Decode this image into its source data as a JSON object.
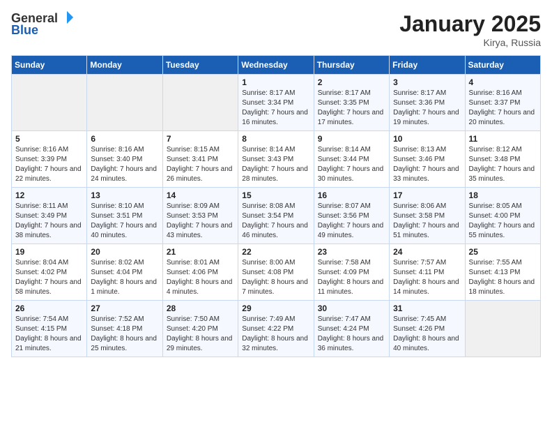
{
  "logo": {
    "text_general": "General",
    "text_blue": "Blue"
  },
  "title": "January 2025",
  "location": "Kirya, Russia",
  "days_of_week": [
    "Sunday",
    "Monday",
    "Tuesday",
    "Wednesday",
    "Thursday",
    "Friday",
    "Saturday"
  ],
  "weeks": [
    [
      {
        "day": "",
        "sunrise": "",
        "sunset": "",
        "daylight": ""
      },
      {
        "day": "",
        "sunrise": "",
        "sunset": "",
        "daylight": ""
      },
      {
        "day": "",
        "sunrise": "",
        "sunset": "",
        "daylight": ""
      },
      {
        "day": "1",
        "sunrise": "Sunrise: 8:17 AM",
        "sunset": "Sunset: 3:34 PM",
        "daylight": "Daylight: 7 hours and 16 minutes."
      },
      {
        "day": "2",
        "sunrise": "Sunrise: 8:17 AM",
        "sunset": "Sunset: 3:35 PM",
        "daylight": "Daylight: 7 hours and 17 minutes."
      },
      {
        "day": "3",
        "sunrise": "Sunrise: 8:17 AM",
        "sunset": "Sunset: 3:36 PM",
        "daylight": "Daylight: 7 hours and 19 minutes."
      },
      {
        "day": "4",
        "sunrise": "Sunrise: 8:16 AM",
        "sunset": "Sunset: 3:37 PM",
        "daylight": "Daylight: 7 hours and 20 minutes."
      }
    ],
    [
      {
        "day": "5",
        "sunrise": "Sunrise: 8:16 AM",
        "sunset": "Sunset: 3:39 PM",
        "daylight": "Daylight: 7 hours and 22 minutes."
      },
      {
        "day": "6",
        "sunrise": "Sunrise: 8:16 AM",
        "sunset": "Sunset: 3:40 PM",
        "daylight": "Daylight: 7 hours and 24 minutes."
      },
      {
        "day": "7",
        "sunrise": "Sunrise: 8:15 AM",
        "sunset": "Sunset: 3:41 PM",
        "daylight": "Daylight: 7 hours and 26 minutes."
      },
      {
        "day": "8",
        "sunrise": "Sunrise: 8:14 AM",
        "sunset": "Sunset: 3:43 PM",
        "daylight": "Daylight: 7 hours and 28 minutes."
      },
      {
        "day": "9",
        "sunrise": "Sunrise: 8:14 AM",
        "sunset": "Sunset: 3:44 PM",
        "daylight": "Daylight: 7 hours and 30 minutes."
      },
      {
        "day": "10",
        "sunrise": "Sunrise: 8:13 AM",
        "sunset": "Sunset: 3:46 PM",
        "daylight": "Daylight: 7 hours and 33 minutes."
      },
      {
        "day": "11",
        "sunrise": "Sunrise: 8:12 AM",
        "sunset": "Sunset: 3:48 PM",
        "daylight": "Daylight: 7 hours and 35 minutes."
      }
    ],
    [
      {
        "day": "12",
        "sunrise": "Sunrise: 8:11 AM",
        "sunset": "Sunset: 3:49 PM",
        "daylight": "Daylight: 7 hours and 38 minutes."
      },
      {
        "day": "13",
        "sunrise": "Sunrise: 8:10 AM",
        "sunset": "Sunset: 3:51 PM",
        "daylight": "Daylight: 7 hours and 40 minutes."
      },
      {
        "day": "14",
        "sunrise": "Sunrise: 8:09 AM",
        "sunset": "Sunset: 3:53 PM",
        "daylight": "Daylight: 7 hours and 43 minutes."
      },
      {
        "day": "15",
        "sunrise": "Sunrise: 8:08 AM",
        "sunset": "Sunset: 3:54 PM",
        "daylight": "Daylight: 7 hours and 46 minutes."
      },
      {
        "day": "16",
        "sunrise": "Sunrise: 8:07 AM",
        "sunset": "Sunset: 3:56 PM",
        "daylight": "Daylight: 7 hours and 49 minutes."
      },
      {
        "day": "17",
        "sunrise": "Sunrise: 8:06 AM",
        "sunset": "Sunset: 3:58 PM",
        "daylight": "Daylight: 7 hours and 51 minutes."
      },
      {
        "day": "18",
        "sunrise": "Sunrise: 8:05 AM",
        "sunset": "Sunset: 4:00 PM",
        "daylight": "Daylight: 7 hours and 55 minutes."
      }
    ],
    [
      {
        "day": "19",
        "sunrise": "Sunrise: 8:04 AM",
        "sunset": "Sunset: 4:02 PM",
        "daylight": "Daylight: 7 hours and 58 minutes."
      },
      {
        "day": "20",
        "sunrise": "Sunrise: 8:02 AM",
        "sunset": "Sunset: 4:04 PM",
        "daylight": "Daylight: 8 hours and 1 minute."
      },
      {
        "day": "21",
        "sunrise": "Sunrise: 8:01 AM",
        "sunset": "Sunset: 4:06 PM",
        "daylight": "Daylight: 8 hours and 4 minutes."
      },
      {
        "day": "22",
        "sunrise": "Sunrise: 8:00 AM",
        "sunset": "Sunset: 4:08 PM",
        "daylight": "Daylight: 8 hours and 7 minutes."
      },
      {
        "day": "23",
        "sunrise": "Sunrise: 7:58 AM",
        "sunset": "Sunset: 4:09 PM",
        "daylight": "Daylight: 8 hours and 11 minutes."
      },
      {
        "day": "24",
        "sunrise": "Sunrise: 7:57 AM",
        "sunset": "Sunset: 4:11 PM",
        "daylight": "Daylight: 8 hours and 14 minutes."
      },
      {
        "day": "25",
        "sunrise": "Sunrise: 7:55 AM",
        "sunset": "Sunset: 4:13 PM",
        "daylight": "Daylight: 8 hours and 18 minutes."
      }
    ],
    [
      {
        "day": "26",
        "sunrise": "Sunrise: 7:54 AM",
        "sunset": "Sunset: 4:15 PM",
        "daylight": "Daylight: 8 hours and 21 minutes."
      },
      {
        "day": "27",
        "sunrise": "Sunrise: 7:52 AM",
        "sunset": "Sunset: 4:18 PM",
        "daylight": "Daylight: 8 hours and 25 minutes."
      },
      {
        "day": "28",
        "sunrise": "Sunrise: 7:50 AM",
        "sunset": "Sunset: 4:20 PM",
        "daylight": "Daylight: 8 hours and 29 minutes."
      },
      {
        "day": "29",
        "sunrise": "Sunrise: 7:49 AM",
        "sunset": "Sunset: 4:22 PM",
        "daylight": "Daylight: 8 hours and 32 minutes."
      },
      {
        "day": "30",
        "sunrise": "Sunrise: 7:47 AM",
        "sunset": "Sunset: 4:24 PM",
        "daylight": "Daylight: 8 hours and 36 minutes."
      },
      {
        "day": "31",
        "sunrise": "Sunrise: 7:45 AM",
        "sunset": "Sunset: 4:26 PM",
        "daylight": "Daylight: 8 hours and 40 minutes."
      },
      {
        "day": "",
        "sunrise": "",
        "sunset": "",
        "daylight": ""
      }
    ]
  ]
}
